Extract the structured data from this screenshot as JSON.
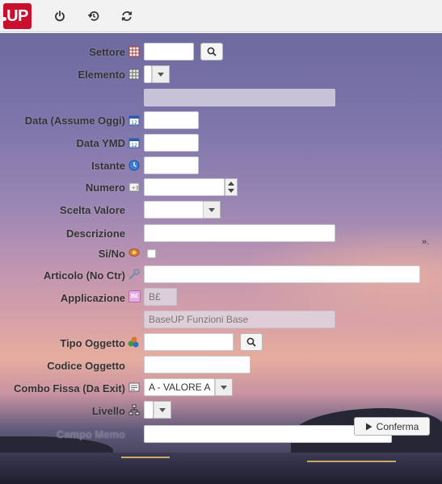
{
  "app": {
    "logo_text": "UP"
  },
  "toolbar": {
    "icons": [
      "power-icon",
      "history-icon",
      "refresh-icon"
    ]
  },
  "form": {
    "settore": {
      "label": "Settore",
      "value": ""
    },
    "elemento": {
      "label": "Elemento",
      "value": "",
      "sub_value": ""
    },
    "data_assume_oggi": {
      "label": "Data (Assume Oggi)",
      "value": ""
    },
    "data_ymd": {
      "label": "Data YMD",
      "value": ""
    },
    "istante": {
      "label": "Istante",
      "value": ""
    },
    "numero": {
      "label": "Numero",
      "value": ""
    },
    "scelta_valore": {
      "label": "Scelta Valore",
      "value": ""
    },
    "descrizione": {
      "label": "Descrizione",
      "value": ""
    },
    "si_no": {
      "label": "Si/No",
      "checked": false
    },
    "articolo": {
      "label": "Articolo (No Ctr)",
      "value": "",
      "more": "»."
    },
    "applicazione": {
      "label": "Applicazione",
      "value": "B£",
      "description": "BaseUP Funzioni Base",
      "icon_text": "B£"
    },
    "tipo_oggetto": {
      "label": "Tipo Oggetto",
      "value": ""
    },
    "codice_oggetto": {
      "label": "Codice Oggetto",
      "value": ""
    },
    "combo_fissa": {
      "label": "Combo Fissa (Da Exit)",
      "value": "A - VALORE A"
    },
    "livello": {
      "label": "Livello",
      "value": ""
    },
    "campo_memo": {
      "label": "Campo Memo",
      "value": ""
    },
    "confirm_label": "Conferma"
  },
  "colors": {
    "brand": "#c8102e"
  }
}
